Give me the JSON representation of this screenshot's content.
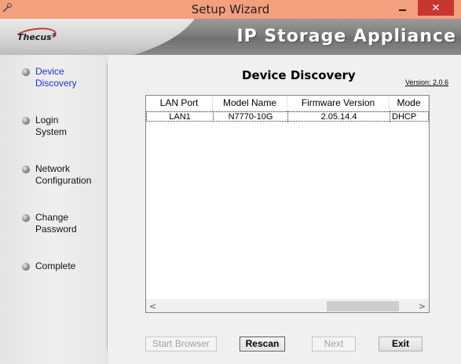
{
  "window": {
    "title": "Setup Wizard",
    "app_icon": "wizard-icon",
    "minimize_icon": "minimize-icon",
    "maximize_icon": "maximize-icon",
    "close_label": "✕"
  },
  "banner": {
    "logo_text": "Thecus",
    "logo_mark": "®",
    "product_name": "IP Storage Appliance"
  },
  "sidebar": {
    "steps": [
      {
        "line1": "Device",
        "line2": "Discovery",
        "active": true
      },
      {
        "line1": "Login",
        "line2": "System",
        "active": false
      },
      {
        "line1": "Network",
        "line2": "Configuration",
        "active": false
      },
      {
        "line1": "Change",
        "line2": "Password",
        "active": false
      },
      {
        "line1": "Complete",
        "line2": "",
        "active": false
      }
    ],
    "active_color": "#1a35d8"
  },
  "main": {
    "heading": "Device Discovery",
    "version": "Version: 2.0.6"
  },
  "device_list": {
    "columns": [
      "LAN Port",
      "Model Name",
      "Firmware Version",
      "Mode"
    ],
    "rows": [
      [
        "LAN1",
        "N7770-10G",
        "2.05.14.4",
        "DHCP"
      ]
    ],
    "scroll_left_label": "<",
    "scroll_right_label": ">"
  },
  "buttons": {
    "start_browser": "Start Browser",
    "rescan": "Rescan",
    "next": "Next",
    "exit": "Exit"
  },
  "colors": {
    "titlebar": "#f3a07e",
    "close_button": "#c7372f"
  }
}
